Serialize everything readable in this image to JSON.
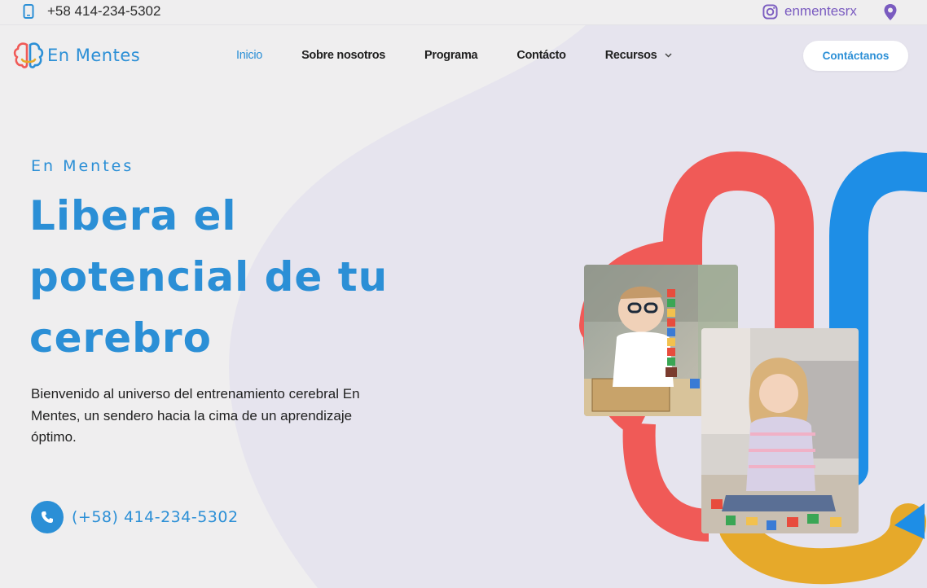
{
  "topbar": {
    "phone": "+58 414-234-5302",
    "instagram": "enmentesrx",
    "phone_icon": "mobile-phone-icon",
    "instagram_icon": "instagram-icon",
    "location_icon": "map-pin-icon"
  },
  "header": {
    "logo_text": "En Mentes",
    "logo_icon": "brain-logo-icon",
    "nav": [
      {
        "label": "Inicio",
        "active": true
      },
      {
        "label": "Sobre nosotros"
      },
      {
        "label": "Programa"
      },
      {
        "label": "Contácto"
      },
      {
        "label": "Recursos",
        "has_dropdown": true
      }
    ],
    "cta_label": "Contáctanos"
  },
  "hero": {
    "eyebrow": "En Mentes",
    "headline_lines": [
      "Libera el",
      "potencial de tu",
      "cerebro"
    ],
    "lead": "Bienvenido al universo del entrenamiento cerebral En Mentes, un sendero hacia la cima de un aprendizaje óptimo.",
    "phone": "(+58) 414-234-5302",
    "phone_icon": "phone-icon"
  },
  "colors": {
    "brand_blue": "#2b8fd6",
    "coral": "#f05a57",
    "mustard": "#e6a92a",
    "purple": "#7a5bc0",
    "background": "#efeeef"
  }
}
